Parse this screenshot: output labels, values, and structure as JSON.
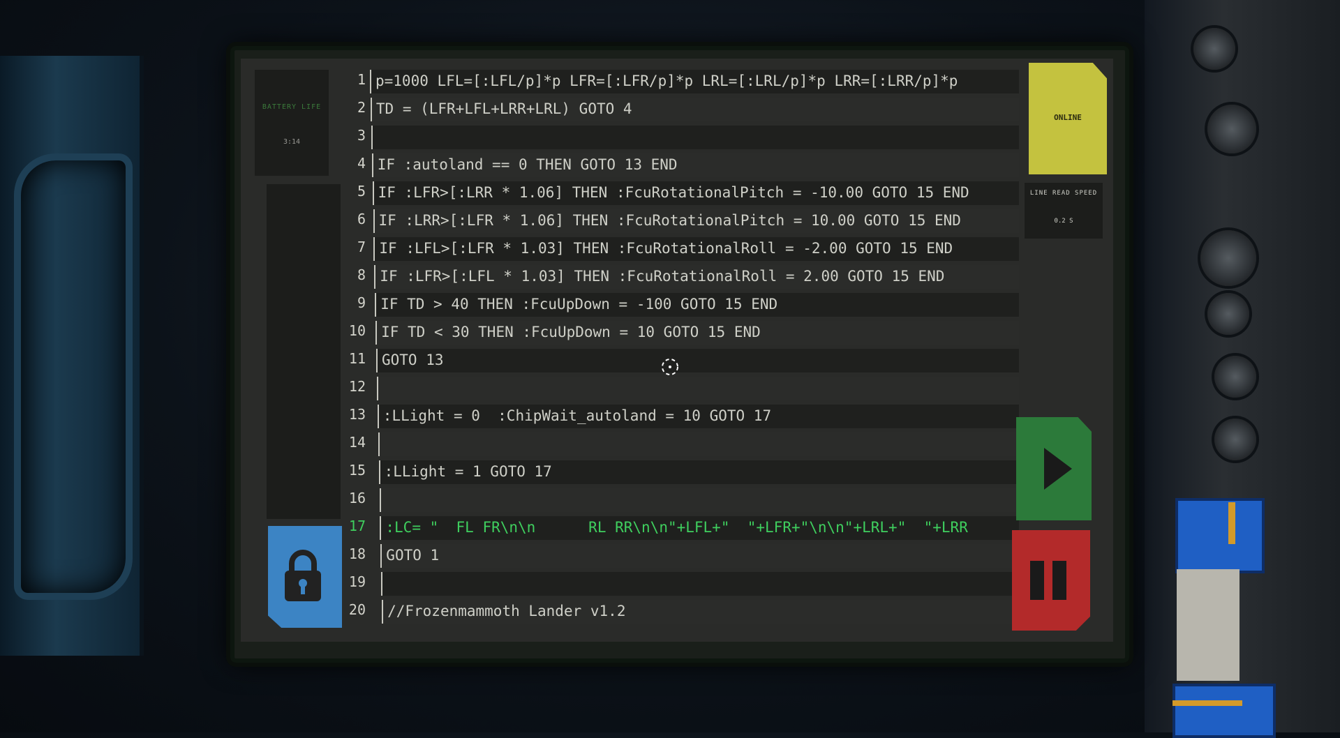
{
  "battery": {
    "label": "BATTERY LIFE",
    "time": "3:14"
  },
  "status": {
    "online_label": "ONLINE"
  },
  "line_speed": {
    "label": "LINE READ SPEED",
    "value": "0.2 S"
  },
  "colors": {
    "screen": "#2a2b29",
    "active_line": "#3fcf5e",
    "online": "#c4c23f",
    "play": "#2c7a3a",
    "pause": "#b32a2a",
    "lock": "#3c84c4"
  },
  "code": {
    "active_line": 17,
    "lines": [
      {
        "n": "1",
        "text": "p=1000 LFL=[:LFL/p]*p LFR=[:LFR/p]*p LRL=[:LRL/p]*p LRR=[:LRR/p]*p"
      },
      {
        "n": "2",
        "text": "TD = (LFR+LFL+LRR+LRL) GOTO 4"
      },
      {
        "n": "3",
        "text": ""
      },
      {
        "n": "4",
        "text": "IF :autoland == 0 THEN GOTO 13 END"
      },
      {
        "n": "5",
        "text": "IF :LFR>[:LRR * 1.06] THEN :FcuRotationalPitch = -10.00 GOTO 15 END"
      },
      {
        "n": "6",
        "text": "IF :LRR>[:LFR * 1.06] THEN :FcuRotationalPitch = 10.00 GOTO 15 END"
      },
      {
        "n": "7",
        "text": "IF :LFL>[:LFR * 1.03] THEN :FcuRotationalRoll = -2.00 GOTO 15 END"
      },
      {
        "n": "8",
        "text": "IF :LFR>[:LFL * 1.03] THEN :FcuRotationalRoll = 2.00 GOTO 15 END"
      },
      {
        "n": "9",
        "text": "IF TD > 40 THEN :FcuUpDown = -100 GOTO 15 END"
      },
      {
        "n": "10",
        "text": "IF TD < 30 THEN :FcuUpDown = 10 GOTO 15 END"
      },
      {
        "n": "11",
        "text": "GOTO 13"
      },
      {
        "n": "12",
        "text": ""
      },
      {
        "n": "13",
        "text": ":LLight = 0  :ChipWait_autoland = 10 GOTO 17"
      },
      {
        "n": "14",
        "text": ""
      },
      {
        "n": "15",
        "text": ":LLight = 1 GOTO 17"
      },
      {
        "n": "16",
        "text": ""
      },
      {
        "n": "17",
        "text": ":LC= \"  FL FR\\n\\n      RL RR\\n\\n\"+LFL+\"  \"+LFR+\"\\n\\n\"+LRL+\"  \"+LRR"
      },
      {
        "n": "18",
        "text": "GOTO 1"
      },
      {
        "n": "19",
        "text": ""
      },
      {
        "n": "20",
        "text": "//Frozenmammoth Lander v1.2"
      }
    ]
  }
}
